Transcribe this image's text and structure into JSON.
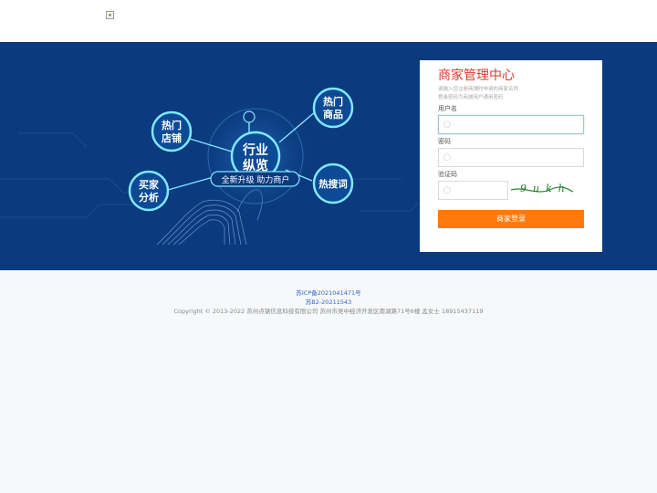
{
  "header": {
    "logo_icon": "broken-image-icon"
  },
  "banner": {
    "center_title": "行业纵览",
    "subtitle": "全新升级 助力商户",
    "bubbles": [
      {
        "id": "hot-shops",
        "line1": "热门",
        "line2": "店铺"
      },
      {
        "id": "hot-goods",
        "line1": "热门",
        "line2": "商品"
      },
      {
        "id": "buyer-analysis",
        "line1": "买家",
        "line2": "分析"
      },
      {
        "id": "hot-search",
        "line1": "热搜词",
        "line2": ""
      }
    ],
    "colors": {
      "background": "#0b3a7e",
      "accent": "#7fe8ff"
    }
  },
  "login": {
    "title": "商家管理中心",
    "hint_line1": "请输入您注册商铺时申请的商家名称",
    "hint_line2": "登录密码为商城用户通用密码",
    "username_label": "用户名",
    "password_label": "密码",
    "captcha_label": "验证码",
    "username_value": "",
    "password_value": "",
    "captcha_value": "",
    "captcha_image_text": "9ukh",
    "submit_label": "商家登录",
    "colors": {
      "title": "#e23a2f",
      "button": "#ff7a0d"
    }
  },
  "footer": {
    "icp": "苏ICP备2021041471号",
    "license": "苏B2-20211543",
    "copyright": "Copyright © 2013-2022 苏州点锯信息科技有限公司 苏州市吴中经济开发区南湖路71号6楼 孟女士 18915437119"
  }
}
